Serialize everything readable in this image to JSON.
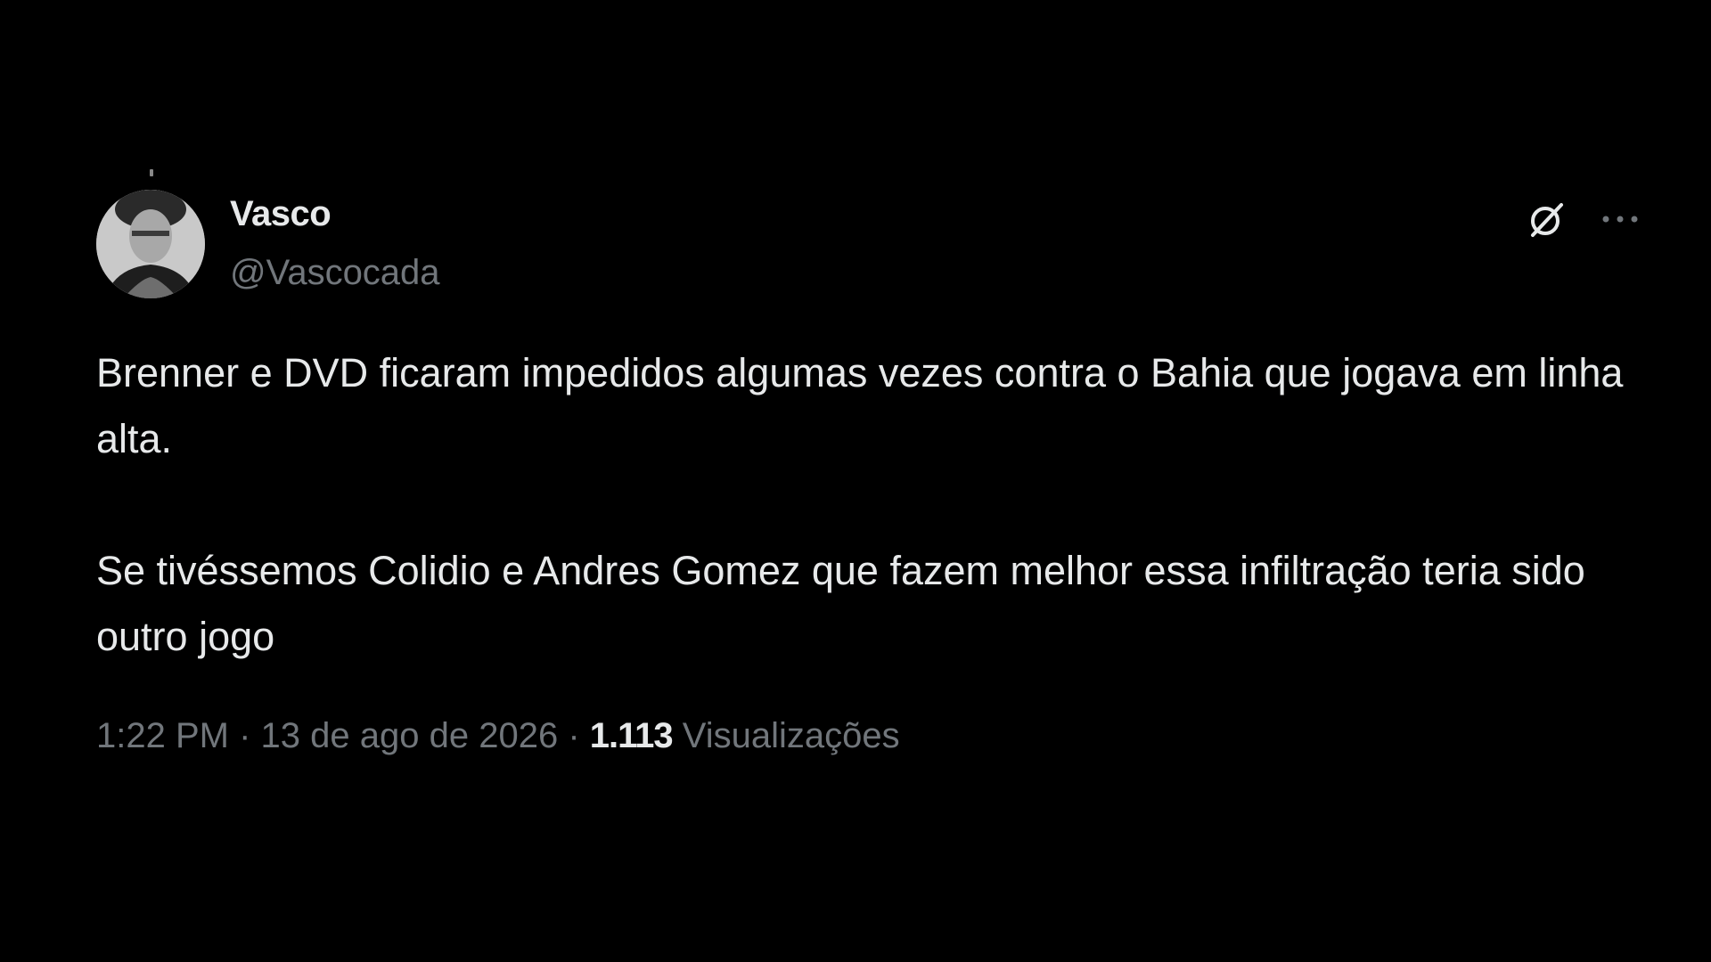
{
  "tweet": {
    "author": {
      "display_name": "Vasco",
      "handle": "@Vascocada"
    },
    "text_paragraphs": [
      "Brenner e DVD ficaram impedidos algumas vezes contra o Bahia que jogava em linha alta.",
      "Se tivéssemos Colidio e Andres Gomez que fazem melhor essa infiltração teria sido outro jogo"
    ],
    "time": "1:22 PM",
    "separator": "·",
    "date": "13 de ago de 2026",
    "views_count": "1.113",
    "views_label": "Visualizações"
  },
  "icons": {
    "grok": "grok-icon",
    "more": "more-options-icon"
  },
  "colors": {
    "background": "#000000",
    "primary_text": "#e7e9ea",
    "secondary_text": "#71767b"
  }
}
